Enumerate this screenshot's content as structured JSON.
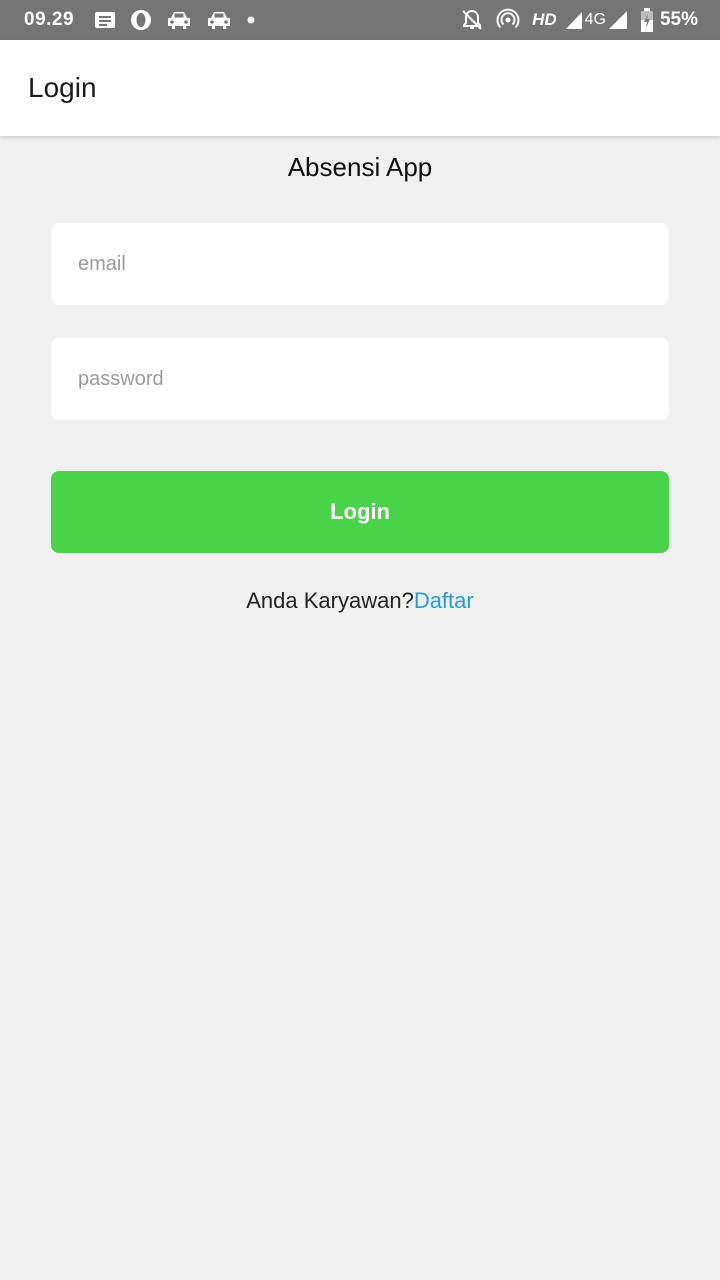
{
  "status_bar": {
    "time": "09.29",
    "network_label": "HD",
    "network_type": "4G",
    "battery": "55%",
    "left_icons": [
      "message-icon",
      "opera-icon",
      "car-icon",
      "car-icon",
      "dot-icon"
    ],
    "right_icons": [
      "notifications-off-icon",
      "hotspot-icon",
      "signal-icon",
      "signal-icon",
      "battery-icon"
    ]
  },
  "app_bar": {
    "title": "Login"
  },
  "main": {
    "app_name": "Absensi App",
    "email_placeholder": "email",
    "email_value": "",
    "password_placeholder": "password",
    "password_value": "",
    "login_button": "Login",
    "register_prompt": "Anda Karyawan?",
    "register_link": "Daftar"
  },
  "colors": {
    "status_bar": "#757575",
    "background": "#f0f0f0",
    "button": "#49d349",
    "link": "#1e9fd6"
  }
}
